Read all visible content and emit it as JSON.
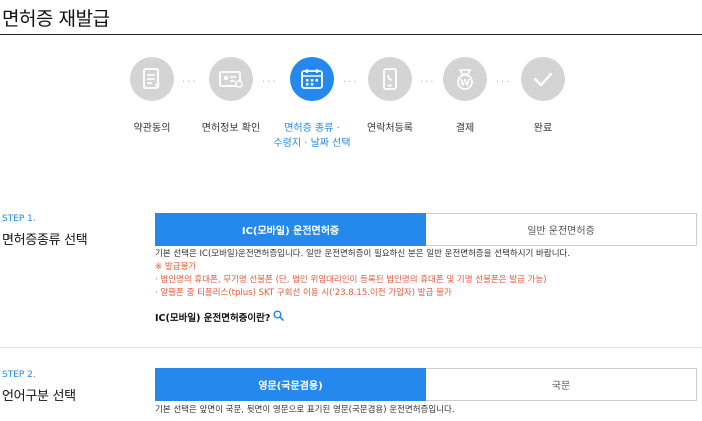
{
  "page": {
    "title": "면허증 재발급"
  },
  "colors": {
    "accent": "#2488ec",
    "inactive_circle": "#d4d4d4",
    "warning": "#e25b3a"
  },
  "stepper": {
    "steps": [
      {
        "label": "약관동의",
        "icon": "document-icon",
        "active": false
      },
      {
        "label": "면허정보 확인",
        "icon": "id-card-icon",
        "active": false
      },
      {
        "label": "면허증 종류 ·",
        "label2": "수령지 · 날짜 선택",
        "icon": "calendar-icon",
        "active": true
      },
      {
        "label": "연락처등록",
        "icon": "phone-icon",
        "active": false
      },
      {
        "label": "결제",
        "icon": "payment-icon",
        "active": false
      },
      {
        "label": "완료",
        "icon": "check-icon",
        "active": false
      }
    ]
  },
  "step1": {
    "tag": "STEP 1.",
    "title": "면허증종류 선택",
    "options": [
      "IC(모바일) 운전면허증",
      "일반 운전면허증"
    ],
    "selected": "IC(모바일) 운전면허증",
    "description": "기본 선택은 IC(모바일)운전면허증입니다. 일반 운전면허증이 필요하신 분은 일반 운전면허증을 선택하시기 바랍니다.",
    "notice_title": "※ 발급불가",
    "notice_1": "· 법인명의 휴대폰, 무기명 선불폰 (단, 법인 위임대리인이 등록된 법인명의 휴대폰 및 기명 선불폰은 발급 가능)",
    "notice_2": "· 알뜰폰 중 티플러스(tplus) SKT 구회선 이용 시('23.8.15.이전 가입자) 발급 불가",
    "info_link": "IC(모바일) 운전면허증이란?"
  },
  "step2": {
    "tag": "STEP 2.",
    "title": "언어구분 선택",
    "options": [
      "영문(국문겸용)",
      "국문"
    ],
    "selected": "영문(국문겸용)",
    "description": "기본 선택은 앞면이 국문, 뒷면이 영문으로 표기된 영문(국문겸용) 운전면허증입니다."
  }
}
